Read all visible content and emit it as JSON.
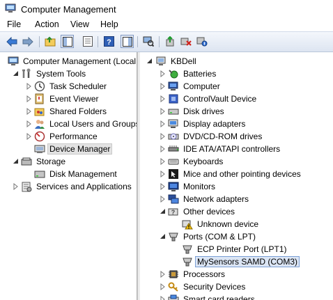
{
  "window": {
    "title": "Computer Management"
  },
  "menu": [
    "File",
    "Action",
    "View",
    "Help"
  ],
  "toolbar": {
    "buttons": [
      "back-icon",
      "forward-icon",
      "up-folder-icon",
      "show-hide-tree-icon",
      "properties-icon",
      "help-icon",
      "show-hide-action-pane-icon",
      "scan-hardware-icon",
      "update-driver-icon",
      "uninstall-icon",
      "disable-device-icon"
    ]
  },
  "left_tree": {
    "root": "Computer Management (Local",
    "system_tools": "System Tools",
    "task_scheduler": "Task Scheduler",
    "event_viewer": "Event Viewer",
    "shared_folders": "Shared Folders",
    "local_users": "Local Users and Groups",
    "performance": "Performance",
    "device_manager": "Device Manager",
    "storage": "Storage",
    "disk_management": "Disk Management",
    "services": "Services and Applications"
  },
  "device_tree": {
    "computer_name": "KBDell",
    "batteries": "Batteries",
    "computer": "Computer",
    "controlvault": "ControlVault Device",
    "disk_drives": "Disk drives",
    "display_adapters": "Display adapters",
    "dvd": "DVD/CD-ROM drives",
    "ide": "IDE ATA/ATAPI controllers",
    "keyboards": "Keyboards",
    "mice": "Mice and other pointing devices",
    "monitors": "Monitors",
    "network": "Network adapters",
    "other_devices": "Other devices",
    "unknown_device": "Unknown device",
    "ports": "Ports (COM & LPT)",
    "ecp": "ECP Printer Port (LPT1)",
    "mysensors": "MySensors SAMD (COM3)",
    "processors": "Processors",
    "security": "Security Devices",
    "smartcard": "Smart card readers"
  },
  "colors": {
    "selection": "#dbe5f4",
    "selection_border": "#7a9ed4",
    "toolbar_bg": "#dde5f1"
  }
}
